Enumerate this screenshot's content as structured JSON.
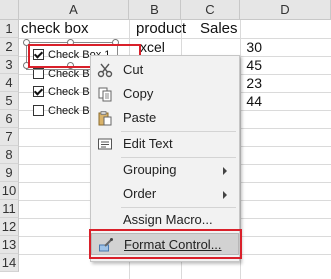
{
  "columns": [
    "A",
    "B",
    "C",
    "D"
  ],
  "rows": [
    "1",
    "2",
    "3",
    "4",
    "5",
    "6",
    "7",
    "8",
    "9",
    "10",
    "11",
    "12",
    "13",
    "14"
  ],
  "header_row": {
    "a": "check box",
    "b": "product",
    "c": "Sales"
  },
  "checkboxes": [
    {
      "label": "Check Box 1",
      "checked": true
    },
    {
      "label": "Check Bo",
      "checked": false
    },
    {
      "label": "Check Bo",
      "checked": true
    },
    {
      "label": "Check Bo",
      "checked": false
    }
  ],
  "b2_partial": "xcel",
  "sales": [
    "30",
    "45",
    "23",
    "44"
  ],
  "menu": {
    "cut": "Cut",
    "copy": "Copy",
    "paste": "Paste",
    "edit_text": "Edit Text",
    "grouping": "Grouping",
    "order": "Order",
    "assign_macro": "Assign Macro...",
    "format_control": "Format Control..."
  },
  "colors": {
    "highlight_box": "#d9202a",
    "menu_bg": "#f2f2f2"
  }
}
